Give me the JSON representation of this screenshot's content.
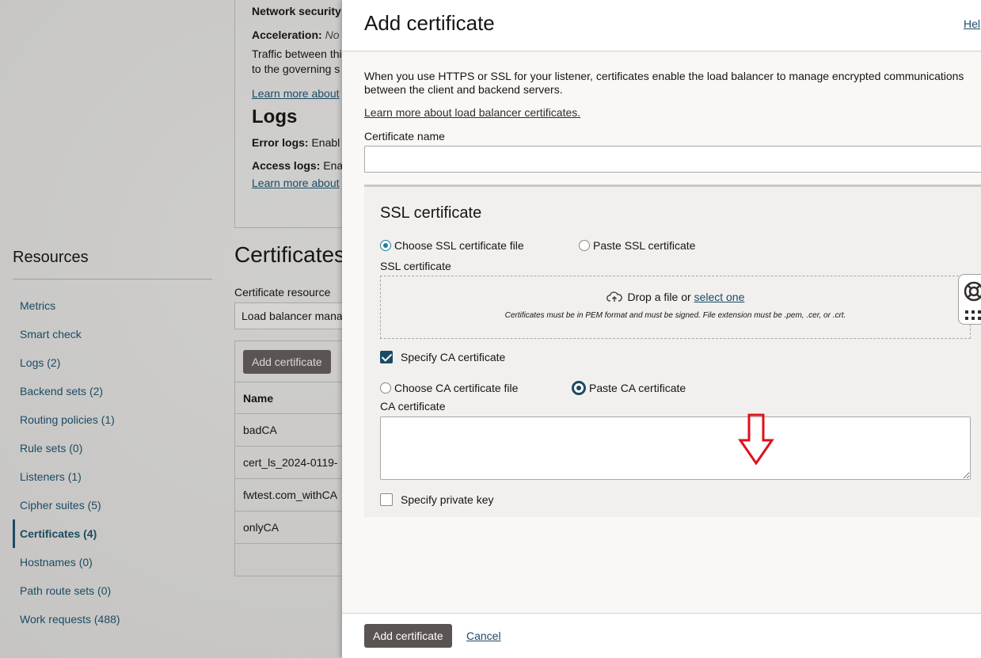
{
  "background": {
    "details": {
      "network_security_label": "Network security",
      "acceleration_label": "Acceleration:",
      "acceleration_value": "No",
      "traffic_text_1": "Traffic between thi",
      "traffic_text_2": "to the governing s",
      "learn_more_1": "Learn more about",
      "logs_heading": "Logs",
      "error_logs_label": "Error logs:",
      "error_logs_value": "Enabl",
      "access_logs_label": "Access logs:",
      "access_logs_value": "Ena",
      "learn_more_2": "Learn more about"
    },
    "resources": {
      "title": "Resources",
      "items": [
        {
          "label": "Metrics"
        },
        {
          "label": "Smart check"
        },
        {
          "label": "Logs (2)"
        },
        {
          "label": "Backend sets (2)"
        },
        {
          "label": "Routing policies (1)"
        },
        {
          "label": "Rule sets (0)"
        },
        {
          "label": "Listeners (1)"
        },
        {
          "label": "Cipher suites (5)"
        },
        {
          "label": "Certificates (4)"
        },
        {
          "label": "Hostnames (0)"
        },
        {
          "label": "Path route sets (0)"
        },
        {
          "label": "Work requests (488)"
        }
      ]
    },
    "certificates": {
      "heading": "Certificates",
      "resource_label": "Certificate resource",
      "resource_value": "Load balancer mana",
      "add_button": "Add certificate",
      "column_name": "Name",
      "rows": [
        {
          "name": "badCA"
        },
        {
          "name": "cert_ls_2024-0119-"
        },
        {
          "name": "fwtest.com_withCA"
        },
        {
          "name": "onlyCA"
        }
      ]
    }
  },
  "panel": {
    "title": "Add certificate",
    "help": "Hel",
    "intro": "When you use HTTPS or SSL for your listener, certificates enable the load balancer to manage encrypted communications between the client and backend servers.",
    "learn_more": "Learn more about load balancer certificates.",
    "cert_name_label": "Certificate name",
    "cert_name_value": "",
    "ssl": {
      "title": "SSL certificate",
      "option_file": "Choose SSL certificate file",
      "option_paste": "Paste SSL certificate",
      "field_label": "SSL certificate",
      "drop_text": "Drop a file or",
      "select_link": "select one",
      "drop_note": "Certificates must be in PEM format and must be signed. File extension must be .pem, .cer, or .crt.",
      "specify_ca": "Specify CA certificate",
      "ca_option_file": "Choose CA certificate file",
      "ca_option_paste": "Paste CA certificate",
      "ca_label": "CA certificate",
      "ca_value": "",
      "specify_private_key": "Specify private key"
    },
    "footer": {
      "add_button": "Add certificate",
      "cancel": "Cancel"
    }
  },
  "colors": {
    "accent": "#1b4b63",
    "button_dark": "#5a5553",
    "arrow_red": "#e0101a"
  }
}
